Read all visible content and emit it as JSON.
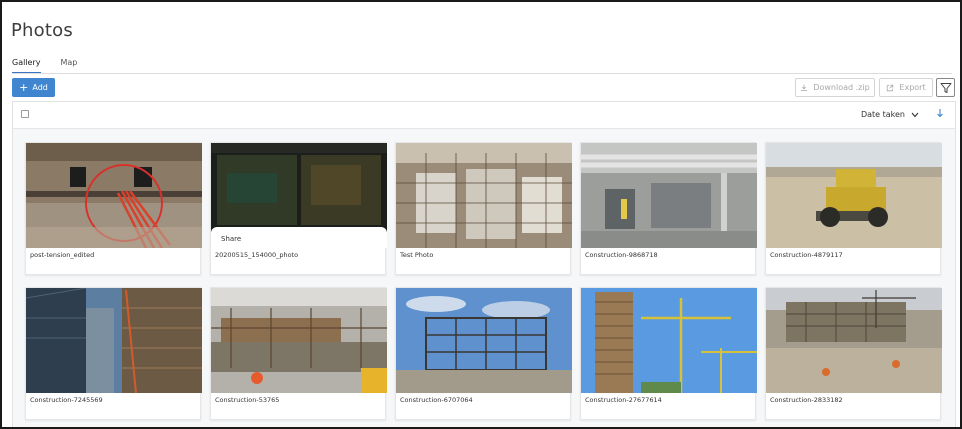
{
  "page": {
    "title": "Photos"
  },
  "tabs": [
    {
      "label": "Gallery",
      "active": true
    },
    {
      "label": "Map",
      "active": false
    }
  ],
  "toolbar": {
    "add_label": "Add",
    "download_label": "Download .zip",
    "export_label": "Export"
  },
  "gallery": {
    "sort_label": "Date taken",
    "photos": [
      {
        "label": "post-tension_edited"
      },
      {
        "label": "20200515_154000_photo",
        "overlay": "Share"
      },
      {
        "label": "Test Photo"
      },
      {
        "label": "Construction-9868718"
      },
      {
        "label": "Construction-4879117"
      },
      {
        "label": "Construction-7245569"
      },
      {
        "label": "Construction-53765"
      },
      {
        "label": "Construction-6707064"
      },
      {
        "label": "Construction-27677614"
      },
      {
        "label": "Construction-2833182"
      }
    ]
  },
  "colors": {
    "accent": "#3f85cf",
    "tab_underline": "#3a78c3"
  }
}
